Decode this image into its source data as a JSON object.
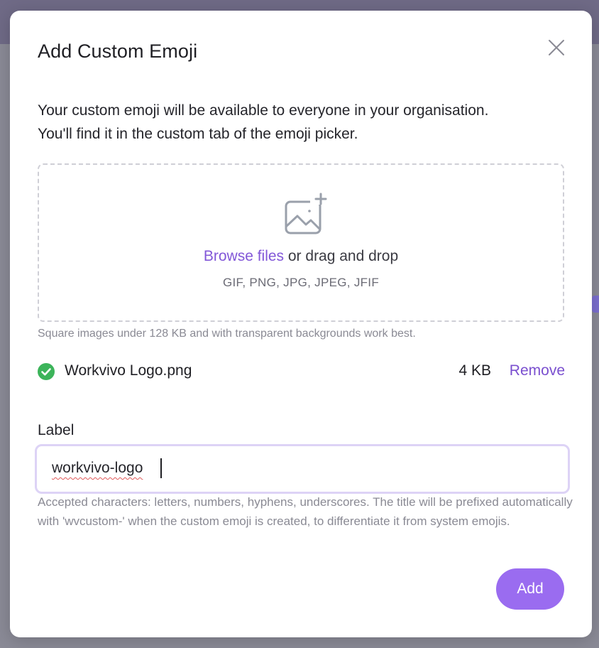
{
  "dialog": {
    "title": "Add Custom Emoji",
    "intro_line1": "Your custom emoji will be available to everyone in your organisation.",
    "intro_line2": "You'll find it in the custom tab of the emoji picker."
  },
  "dropzone": {
    "icon": "image-add-icon",
    "browse_label": "Browse files",
    "drag_text": " or drag and drop",
    "formats": "GIF, PNG, JPG, JPEG, JFIF"
  },
  "hint": "Square images under 128 KB and with transparent backgrounds work best.",
  "file": {
    "status_icon": "check-circle-icon",
    "status_color": "#3cb45a",
    "name": "Workvivo Logo.png",
    "size": "4 KB",
    "remove_label": "Remove"
  },
  "label_field": {
    "label": "Label",
    "value": "workvivo-logo",
    "help": "Accepted characters: letters, numbers, hyphens, underscores. The title will be prefixed automatically with 'wvcustom-' when the custom emoji is created, to differentiate it from system emojis."
  },
  "actions": {
    "add_label": "Add"
  },
  "colors": {
    "accent": "#8257d8",
    "button": "#9a6cf0"
  }
}
